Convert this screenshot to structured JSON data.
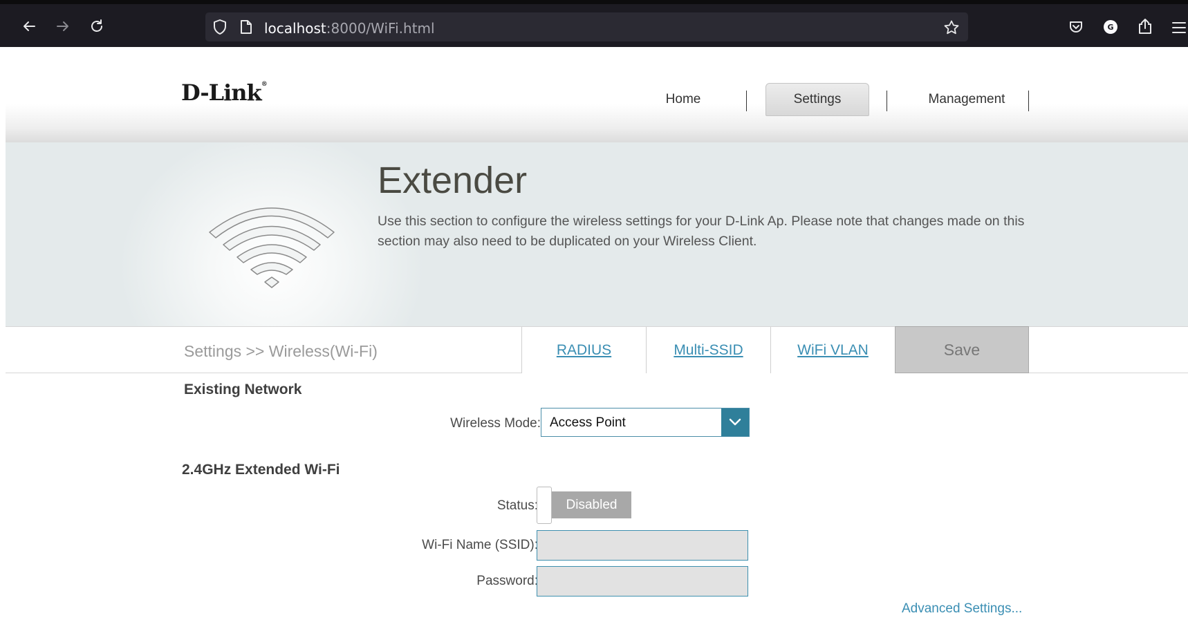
{
  "browser": {
    "url_host": "localhost",
    "url_rest": ":8000/WiFi.html"
  },
  "brand": {
    "logo": "D-Link",
    "trademark": "®"
  },
  "topnav": {
    "items": [
      {
        "label": "Home",
        "active": false
      },
      {
        "label": "Settings",
        "active": true
      },
      {
        "label": "Management",
        "active": false
      }
    ]
  },
  "hero": {
    "title": "Extender",
    "description": "Use this section to configure the wireless settings for your D-Link Ap. Please note that changes made on this section may also need to be duplicated on your Wireless Client."
  },
  "subbar": {
    "breadcrumb": "Settings >> Wireless(Wi-Fi)",
    "tabs": [
      "RADIUS",
      "Multi-SSID",
      "WiFi VLAN"
    ],
    "save_label": "Save"
  },
  "existing_network": {
    "title": "Existing Network",
    "wireless_mode_label": "Wireless Mode:",
    "wireless_mode_value": "Access Point"
  },
  "extended_wifi": {
    "title": "2.4GHz Extended Wi-Fi",
    "status_label": "Status:",
    "status_value": "Disabled",
    "ssid_label": "Wi-Fi Name (SSID):",
    "ssid_value": "",
    "password_label": "Password:",
    "password_value": "",
    "advanced_link": "Advanced Settings..."
  },
  "colors": {
    "accent": "#2f7f9a",
    "link": "#3a8eb3",
    "hero_bg": "#e4eaeb",
    "chrome_bg": "#1c1b22"
  }
}
